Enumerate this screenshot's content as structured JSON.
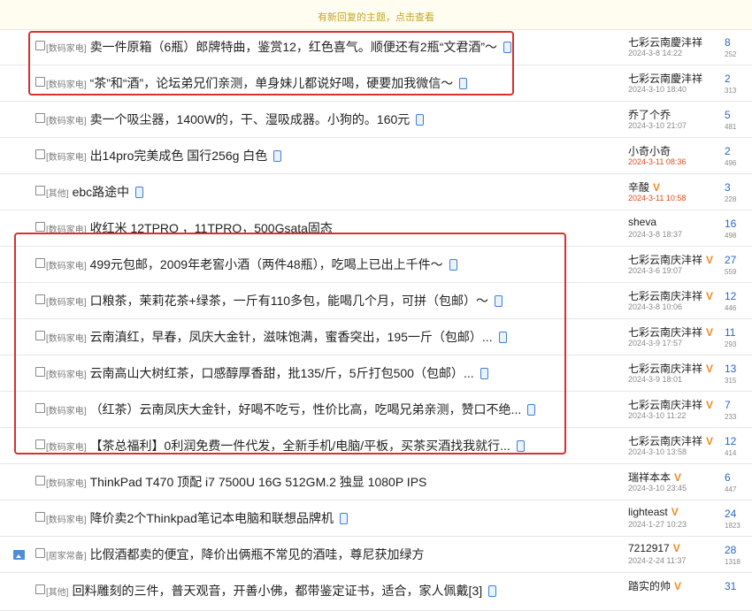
{
  "notice": "有新回复的主题，点击查看",
  "threads": [
    {
      "category": "[数码家电]",
      "title": "卖一件原箱（6瓶）郎牌特曲，鉴赏12，红色喜气。顺便还有2瓶“文君酒”～",
      "mobile": true,
      "author": "七彩云南慶沣祥",
      "vip": false,
      "date": "2024-3-8 14:22",
      "hot": false,
      "replies": "8",
      "views": "252"
    },
    {
      "category": "[数码家电]",
      "title": "“茶”和“酒”，论坛弟兄们亲测，单身妹儿都说好喝，硬要加我微信～",
      "mobile": true,
      "author": "七彩云南慶沣祥",
      "vip": false,
      "date": "2024-3-10 18:40",
      "hot": false,
      "replies": "2",
      "views": "313"
    },
    {
      "category": "[数码家电]",
      "title": "卖一个吸尘器，1400W的，干、湿吸成器。小狗的。160元",
      "mobile": true,
      "author": "乔了个乔",
      "vip": false,
      "date": "2024-3-10 21:07",
      "hot": false,
      "replies": "5",
      "views": "481"
    },
    {
      "category": "[数码家电]",
      "title": "出14pro完美成色 国行256g 白色",
      "mobile": true,
      "author": "小奇小奇",
      "vip": false,
      "date": "2024-3-11 08:36",
      "hot": true,
      "replies": "2",
      "views": "496"
    },
    {
      "category": "[其他]",
      "title": "ebc路途中",
      "mobile": true,
      "author": "辛酸",
      "vip": true,
      "date": "2024-3-11 10:58",
      "hot": true,
      "replies": "3",
      "views": "228"
    },
    {
      "category": "[数码家电]",
      "title": "收红米 12TPRO ，11TPRO，500Gsata固态",
      "mobile": false,
      "author": "sheva",
      "vip": false,
      "date": "2024-3-8 18:37",
      "hot": false,
      "replies": "16",
      "views": "498"
    },
    {
      "category": "[数码家电]",
      "title": "499元包邮，2009年老窖小酒（两件48瓶），吃喝上已出上千件～",
      "mobile": true,
      "author": "七彩云南庆沣祥",
      "vip": true,
      "date": "2024-3-6 19:07",
      "hot": false,
      "replies": "27",
      "views": "559"
    },
    {
      "category": "[数码家电]",
      "title": "口粮茶，茉莉花茶+绿茶，一斤有110多包，能喝几个月，可拼（包邮）～",
      "mobile": true,
      "author": "七彩云南庆沣祥",
      "vip": true,
      "date": "2024-3-8 10:06",
      "hot": false,
      "replies": "12",
      "views": "446"
    },
    {
      "category": "[数码家电]",
      "title": "云南滇红，早春，凤庆大金针，滋味饱满，蜜香突出，195一斤（包邮）...",
      "mobile": true,
      "author": "七彩云南庆沣祥",
      "vip": true,
      "date": "2024-3-9 17:57",
      "hot": false,
      "replies": "11",
      "views": "293"
    },
    {
      "category": "[数码家电]",
      "title": "云南高山大树红茶，口感醇厚香甜，批135/斤，5斤打包500（包邮）...",
      "mobile": true,
      "author": "七彩云南庆沣祥",
      "vip": true,
      "date": "2024-3-9 18:01",
      "hot": false,
      "replies": "13",
      "views": "315"
    },
    {
      "category": "[数码家电]",
      "title": "（红茶）云南凤庆大金针，好喝不吃亏，性价比高，吃喝兄弟亲测，赞口不绝...",
      "mobile": true,
      "author": "七彩云南庆沣祥",
      "vip": true,
      "date": "2024-3-10 11:22",
      "hot": false,
      "replies": "7",
      "views": "233"
    },
    {
      "category": "[数码家电]",
      "title": "【茶总福利】0利润免费一件代发，全新手机/电脑/平板，买茶买酒找我就行...",
      "mobile": true,
      "author": "七彩云南庆沣祥",
      "vip": true,
      "date": "2024-3-10 13:58",
      "hot": false,
      "replies": "12",
      "views": "414"
    },
    {
      "category": "[数码家电]",
      "title": "ThinkPad T470 顶配 i7 7500U 16G 512GM.2 独显 1080P IPS",
      "mobile": false,
      "author": "瑞祥本本",
      "vip": true,
      "date": "2024-3-10 23:45",
      "hot": false,
      "replies": "6",
      "views": "447"
    },
    {
      "category": "[数码家电]",
      "title": "降价卖2个Thinkpad笔记本电脑和联想品牌机",
      "mobile": true,
      "author": "lighteast",
      "vip": true,
      "date": "2024-1-27 10:23",
      "hot": false,
      "replies": "24",
      "views": "1823"
    },
    {
      "category": "[居家常备]",
      "title": "比假酒都卖的便宜，降价出俩瓶不常见的酒哇，尊尼获加绿方",
      "mobile": false,
      "author": "7212917",
      "vip": true,
      "date": "2024-2-24 11:37",
      "hot": false,
      "replies": "28",
      "views": "1318",
      "image": true
    },
    {
      "category": "[其他]",
      "title": "回料雕刻的三件，普天观音，开善小佛，都带鉴定证书，适合，家人佩戴[3]",
      "mobile": true,
      "author": "踏实的帅",
      "vip": true,
      "date": "",
      "hot": false,
      "replies": "31",
      "views": ""
    }
  ]
}
